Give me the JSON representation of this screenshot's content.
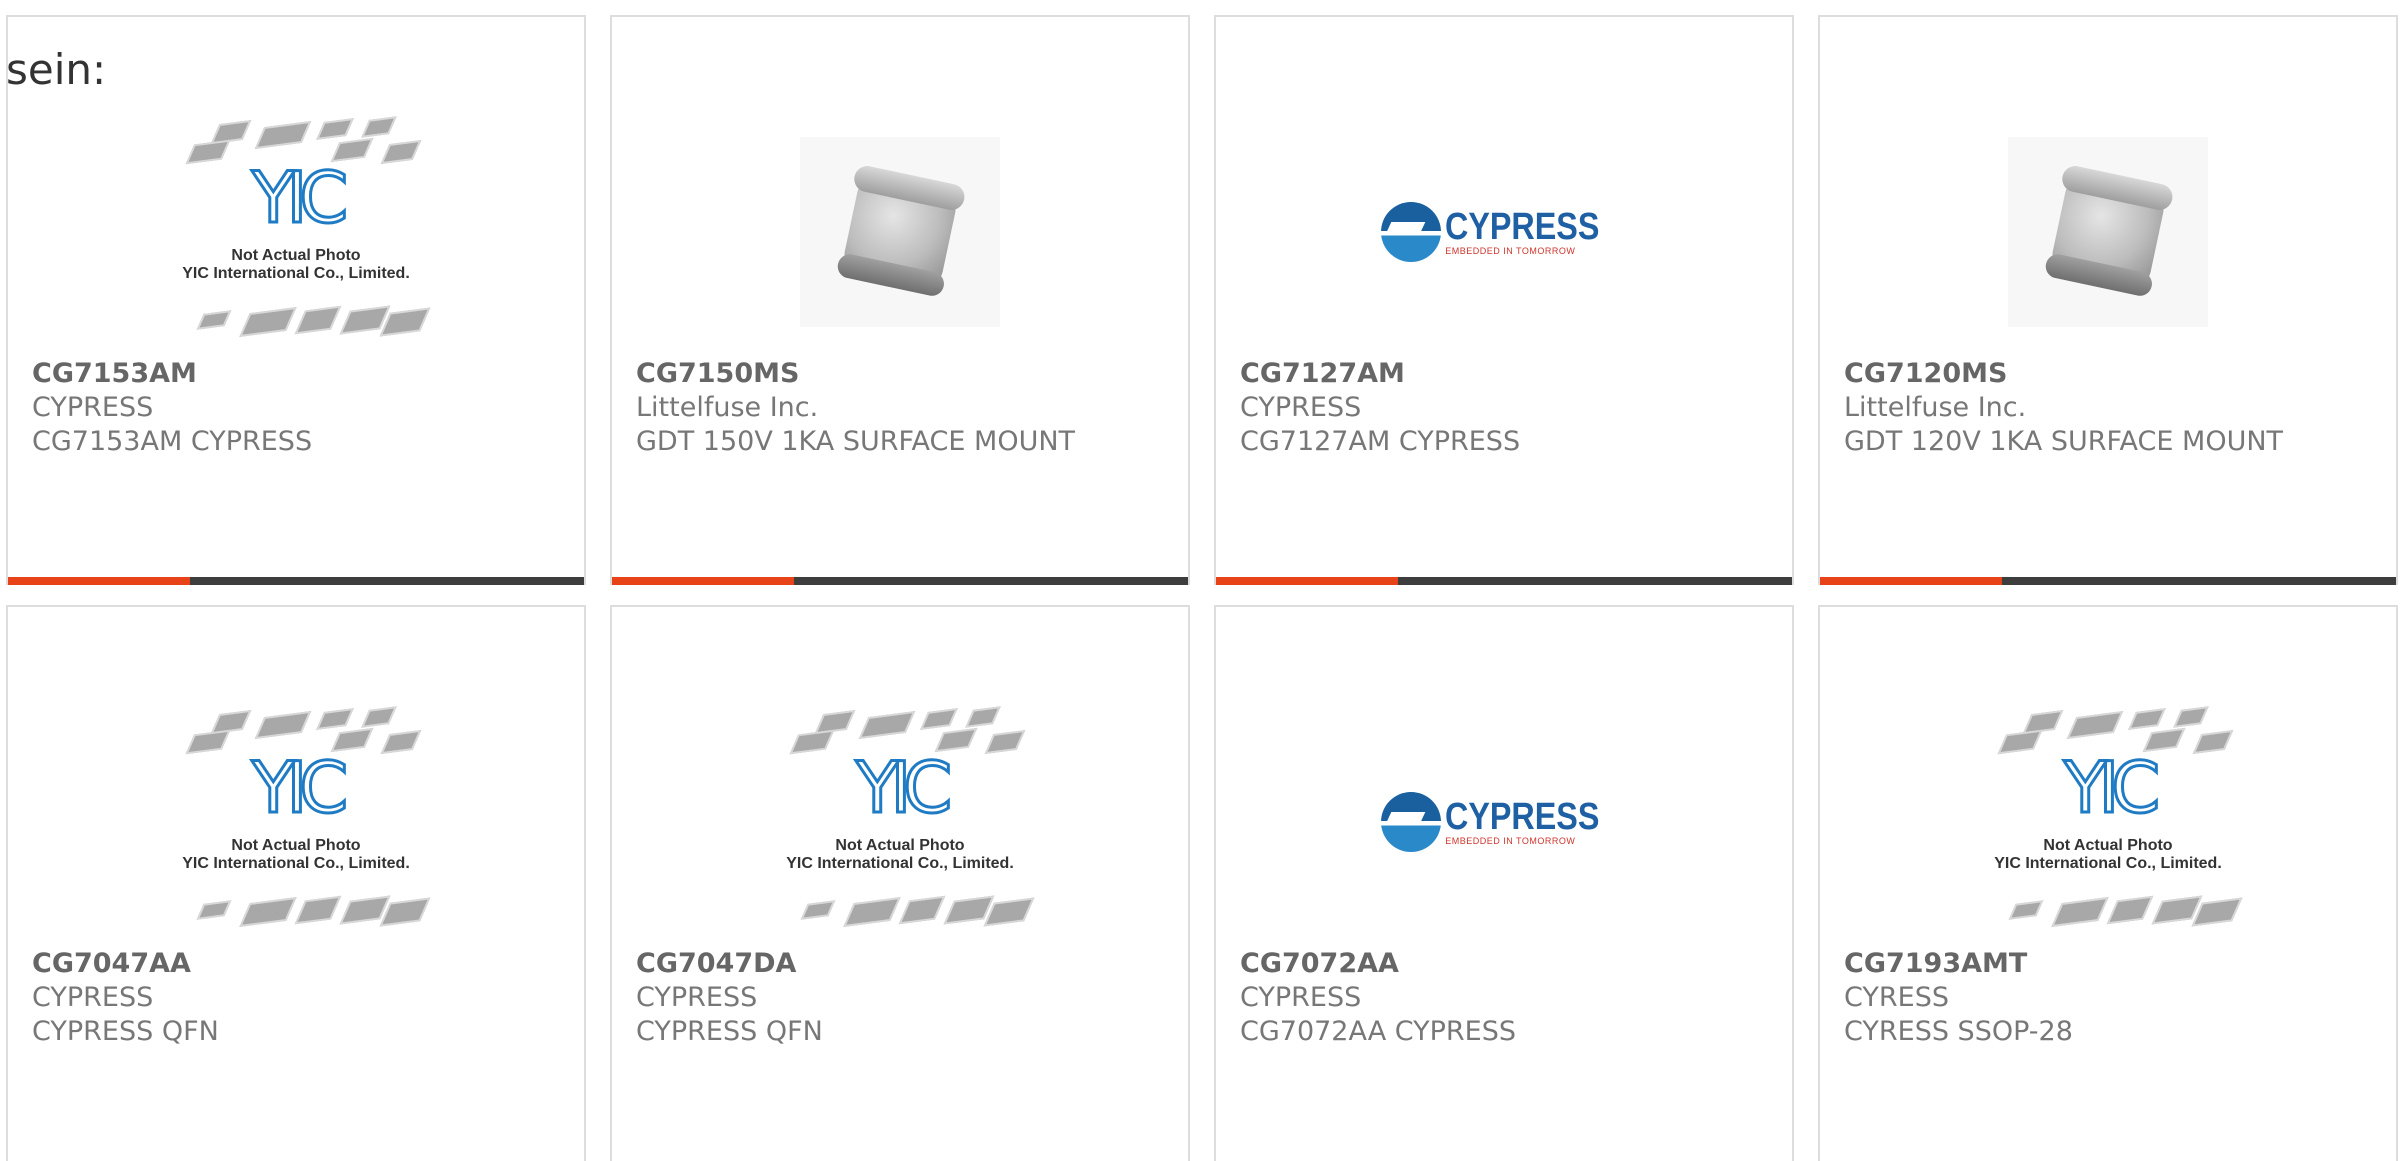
{
  "fragment": "sein:",
  "colors": {
    "accent": "#e84219",
    "bar": "#3d3d3d",
    "border": "#dddddd",
    "text": "#666666"
  },
  "placeholder": {
    "line1": "Not Actual Photo",
    "line2": "YIC International Co., Limited."
  },
  "cypress_logo": {
    "brand": "CYPRESS",
    "tagline": "EMBEDDED IN TOMORROW"
  },
  "products": [
    {
      "part": "CG7153AM",
      "maker": "CYPRESS",
      "desc": "CG7153AM CYPRESS",
      "image": "yic-placeholder"
    },
    {
      "part": "CG7150MS",
      "maker": "Littelfuse Inc.",
      "desc": "GDT 150V 1KA SURFACE MOUNT",
      "image": "gdt-photo"
    },
    {
      "part": "CG7127AM",
      "maker": "CYPRESS",
      "desc": "CG7127AM CYPRESS",
      "image": "cypress-logo"
    },
    {
      "part": "CG7120MS",
      "maker": "Littelfuse Inc.",
      "desc": "GDT 120V 1KA SURFACE MOUNT",
      "image": "gdt-photo"
    },
    {
      "part": "CG7047AA",
      "maker": "CYPRESS",
      "desc": "CYPRESS QFN",
      "image": "yic-placeholder"
    },
    {
      "part": "CG7047DA",
      "maker": "CYPRESS",
      "desc": "CYPRESS QFN",
      "image": "yic-placeholder"
    },
    {
      "part": "CG7072AA",
      "maker": "CYPRESS",
      "desc": "CG7072AA CYPRESS",
      "image": "cypress-logo"
    },
    {
      "part": "CG7193AMT",
      "maker": "CYRESS",
      "desc": "CYRESS SSOP-28",
      "image": "yic-placeholder"
    }
  ]
}
